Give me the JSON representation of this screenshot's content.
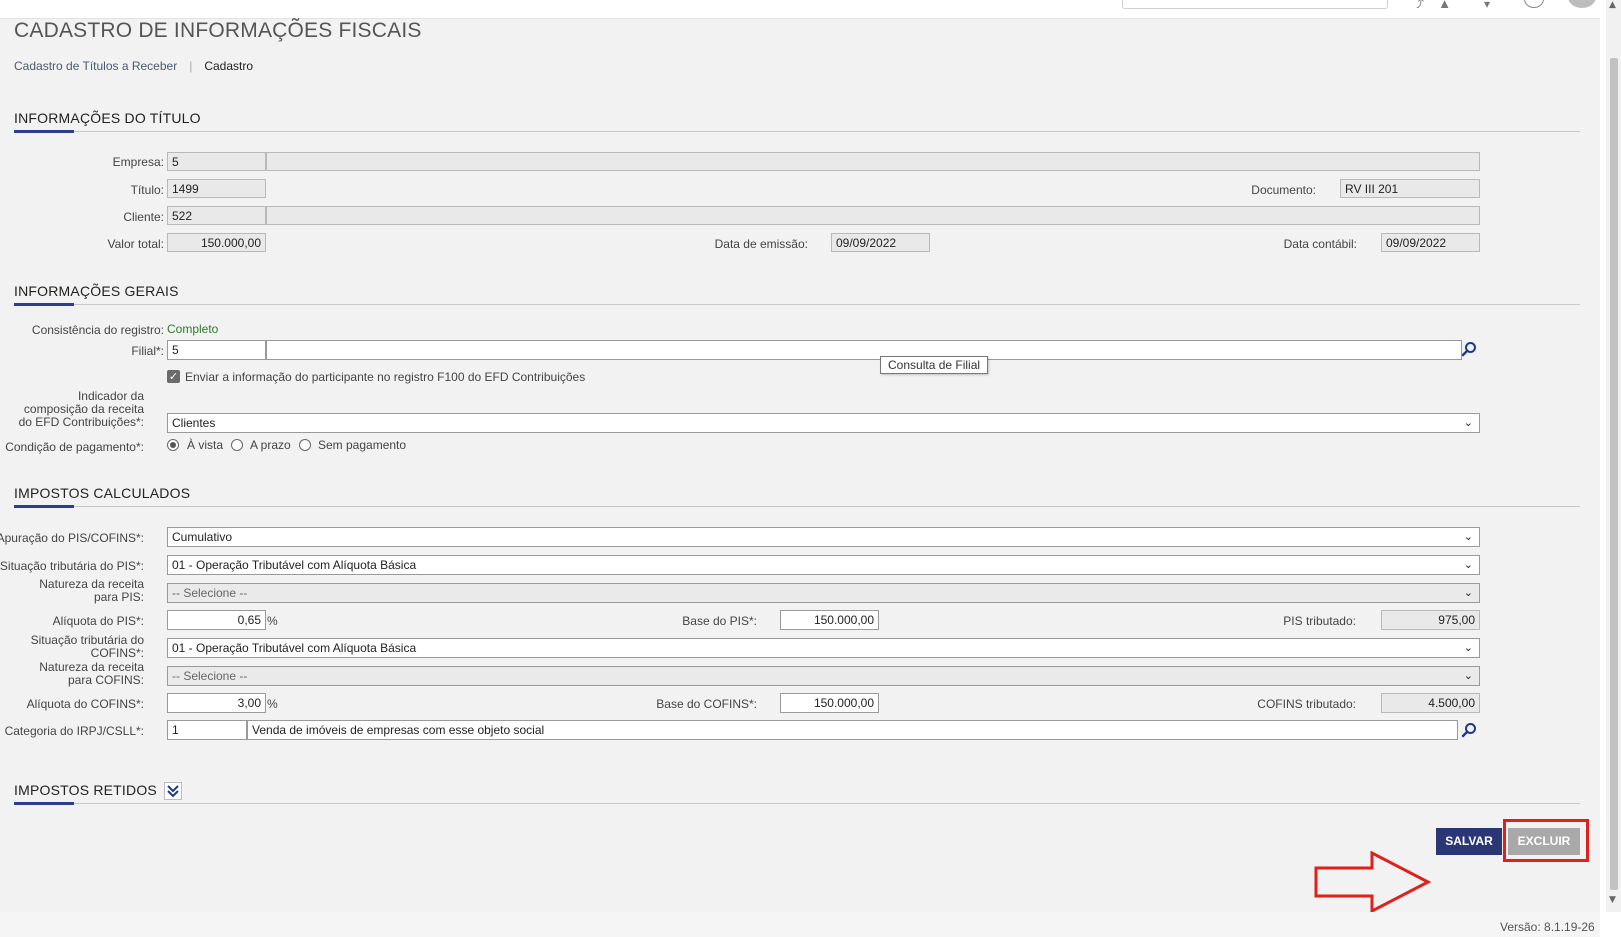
{
  "header": {
    "search_icon": "search-icon",
    "icons": [
      "link-icon",
      "bell-icon",
      "cart-icon",
      "help-icon"
    ]
  },
  "page": {
    "title": "CADASTRO DE INFORMAÇÕES FISCAIS",
    "breadcrumb": [
      "Cadastro de Títulos a Receber",
      "Cadastro"
    ]
  },
  "titulo": {
    "section_title": "INFORMAÇÕES DO TÍTULO",
    "empresa_label": "Empresa:",
    "empresa_code": "5",
    "empresa_name": "",
    "titulo_label": "Título:",
    "titulo_value": "1499",
    "documento_label": "Documento:",
    "documento_value": "RV III 201",
    "cliente_label": "Cliente:",
    "cliente_code": "522",
    "cliente_name": "",
    "valor_total_label": "Valor total:",
    "valor_total_value": "150.000,00",
    "data_emissao_label": "Data de emissão:",
    "data_emissao_value": "09/09/2022",
    "data_contabil_label": "Data contábil:",
    "data_contabil_value": "09/09/2022"
  },
  "gerais": {
    "section_title": "INFORMAÇÕES GERAIS",
    "consistencia_label": "Consistência do registro:",
    "consistencia_value": "Completo",
    "filial_label": "Filial*:",
    "filial_code": "5",
    "filial_name": "",
    "filial_tooltip": "Consulta de Filial",
    "checkbox_label": "Enviar a informação do participante no registro F100 do EFD Contribuições",
    "checkbox_checked": true,
    "indicador_label": "Indicador da composição da receita do EFD Contribuições*:",
    "indicador_value": "Clientes",
    "condicao_label": "Condição de pagamento*:",
    "condicao_options": [
      "À vista",
      "A prazo",
      "Sem pagamento"
    ],
    "condicao_selected": "À vista"
  },
  "impostos": {
    "section_title": "IMPOSTOS CALCULADOS",
    "apuracao_label": "Apuração do PIS/COFINS*:",
    "apuracao_value": "Cumulativo",
    "sit_pis_label": "Situação tributária do PIS*:",
    "sit_pis_value": "01 - Operação Tributável com Alíquota Básica",
    "nat_pis_label": "Natureza da receita para PIS:",
    "nat_pis_value": "-- Selecione --",
    "aliq_pis_label": "Alíquota do PIS*:",
    "aliq_pis_value": "0,65",
    "pct_symbol": "%",
    "base_pis_label": "Base do PIS*:",
    "base_pis_value": "150.000,00",
    "pis_trib_label": "PIS tributado:",
    "pis_trib_value": "975,00",
    "sit_cofins_label": "Situação tributária do COFINS*:",
    "sit_cofins_value": "01 - Operação Tributável com Alíquota Básica",
    "nat_cofins_label": "Natureza da receita para COFINS:",
    "nat_cofins_value": "-- Selecione --",
    "aliq_cofins_label": "Alíquota do COFINS*:",
    "aliq_cofins_value": "3,00",
    "base_cofins_label": "Base do COFINS*:",
    "base_cofins_value": "150.000,00",
    "cofins_trib_label": "COFINS tributado:",
    "cofins_trib_value": "4.500,00",
    "irpj_label": "Categoria do IRPJ/CSLL*:",
    "irpj_code": "1",
    "irpj_desc": "Venda de imóveis de empresas com esse objeto social"
  },
  "retidos": {
    "section_title": "IMPOSTOS RETIDOS"
  },
  "actions": {
    "save_label": "SALVAR",
    "delete_label": "EXCLUIR"
  },
  "footer": {
    "version": "Versão: 8.1.19-26"
  },
  "colors": {
    "primary": "#2a3676",
    "accent_line": "#2c3e8c",
    "annotation_red": "#e0201a",
    "status_green": "#2d7a2d"
  }
}
